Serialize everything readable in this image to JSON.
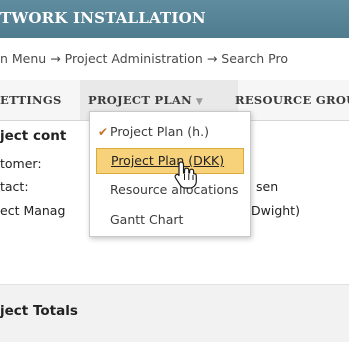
{
  "header": {
    "title": "TWORK INSTALLATION"
  },
  "breadcrumb": {
    "text": "n Menu → Project Administration → Search Pro"
  },
  "tabs": [
    {
      "label": "ETTINGS"
    },
    {
      "label": "PROJECT PLAN"
    },
    {
      "label": "RESOURCE GROU"
    }
  ],
  "content": {
    "section_title": "ject cont",
    "fields": [
      {
        "label": "tomer:",
        "value": ""
      },
      {
        "label": "tact:",
        "value": "sen"
      },
      {
        "label": "ect Manag",
        "value": "Dwight)"
      }
    ],
    "totals_title": "ject Totals"
  },
  "menu": {
    "items": [
      {
        "label": "Project Plan (h.)",
        "checked": true
      },
      {
        "label": "Project Plan (DKK)",
        "checked": false
      },
      {
        "label": "Resource allocations",
        "checked": false
      },
      {
        "label": "Gantt Chart",
        "checked": false
      }
    ]
  },
  "colors": {
    "header": "#4f7c8f",
    "highlight": "#f7d27a",
    "check": "#c0762a"
  }
}
